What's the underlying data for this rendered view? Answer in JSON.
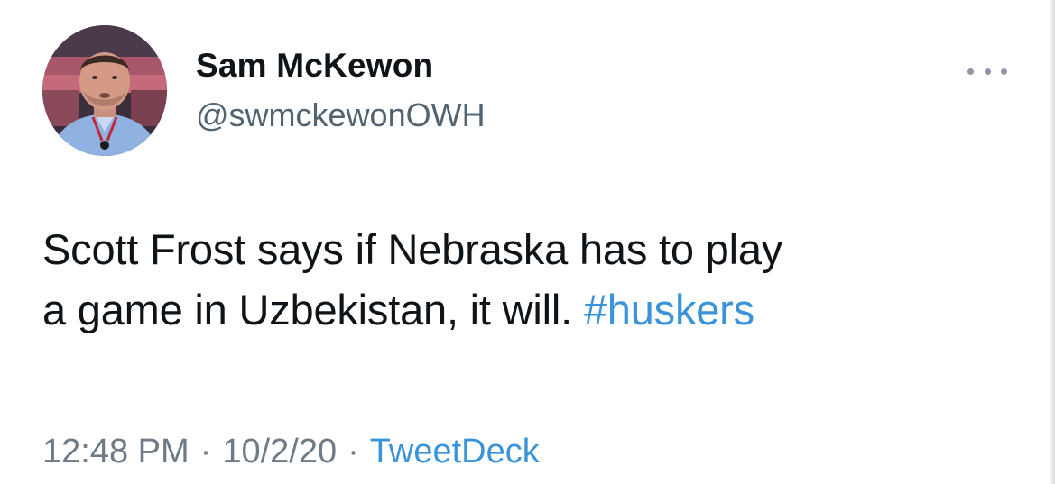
{
  "tweet": {
    "author": {
      "display_name": "Sam McKewon",
      "handle": "@swmckewonOWH",
      "avatar_icon": "profile-photo"
    },
    "more_icon": "more-horizontal-icon",
    "text_line_1": "Scott Frost says if Nebraska has to play",
    "text_line_2": "a game in Uzbekistan, it will. ",
    "hashtag": "#huskers",
    "meta": {
      "time": "12:48 PM",
      "separator": "·",
      "date": "10/2/20",
      "source": "TweetDeck"
    }
  },
  "colors": {
    "link": "#3b94d9",
    "secondary_text": "#536471",
    "primary_text": "#0f1419"
  }
}
